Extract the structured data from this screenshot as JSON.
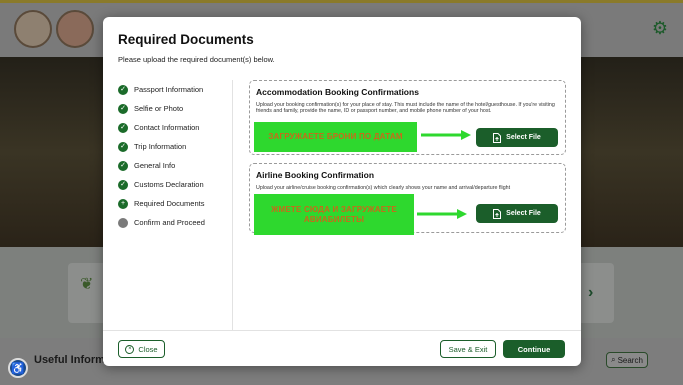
{
  "background": {
    "useful_label": "Useful Informat",
    "search_label": "Search"
  },
  "modal": {
    "title": "Required Documents",
    "subtitle": "Please upload the required document(s) below.",
    "steps": [
      {
        "label": "Passport Information",
        "state": "done"
      },
      {
        "label": "Selfie or Photo",
        "state": "done"
      },
      {
        "label": "Contact Information",
        "state": "done"
      },
      {
        "label": "Trip Information",
        "state": "done"
      },
      {
        "label": "General Info",
        "state": "done"
      },
      {
        "label": "Customs Declaration",
        "state": "done"
      },
      {
        "label": "Required Documents",
        "state": "current"
      },
      {
        "label": "Confirm and Proceed",
        "state": "pending"
      }
    ],
    "documents": [
      {
        "title": "Accommodation Booking Confirmations",
        "description": "Upload your booking confirmation(s) for your place of stay. This must include the name of the hotel/guesthouse. If you're visiting friends and family, provide the name, ID or passport number, and mobile phone number of your host.",
        "button_label": "Select File",
        "annotation": "ЗАГРУЖАЕТЕ БРОНИ ПО ДАТАМ"
      },
      {
        "title": "Airline Booking Confirmation",
        "description": "Upload your airline/cruise booking confirmation(s) which clearly shows your name and arrival/departure flight",
        "button_label": "Select File",
        "annotation": "ЖМЕТЕ СЮДА И ЗАГРУЖАЕТЕ АВИАБИЛЕТЫ"
      }
    ],
    "footer": {
      "close_label": "Close",
      "save_label": "Save & Exit",
      "continue_label": "Continue"
    }
  },
  "colors": {
    "brand_green": "#1b5e2a",
    "annotation_green": "#2ed82e",
    "annotation_text": "#c86a1a"
  }
}
